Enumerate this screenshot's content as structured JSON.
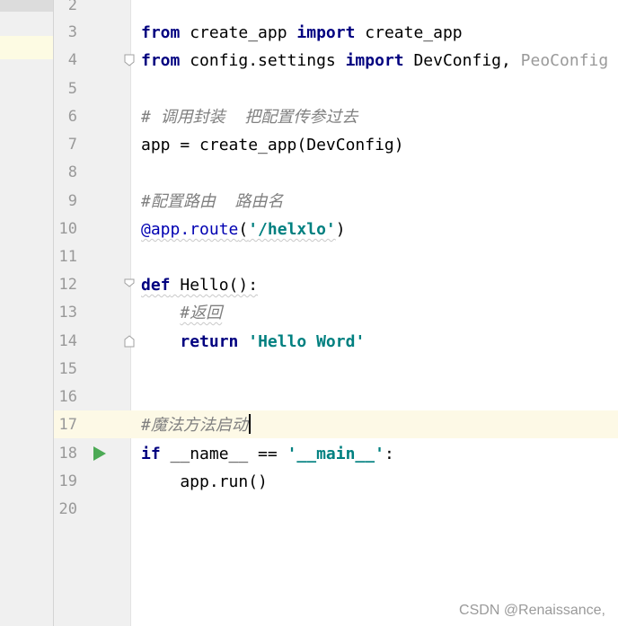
{
  "editor": {
    "line_numbers": [
      "2",
      "3",
      "4",
      "5",
      "6",
      "7",
      "8",
      "9",
      "10",
      "11",
      "12",
      "13",
      "14",
      "15",
      "16",
      "17",
      "18",
      "19",
      "20"
    ],
    "line3": {
      "kw1": "from",
      "mod": " create_app ",
      "kw2": "import",
      "name": " create_app"
    },
    "line4": {
      "kw1": "from",
      "mod": " config.settings ",
      "kw2": "import",
      "name": " DevConfig, ",
      "unused": "PeoConfig"
    },
    "line6": {
      "comment": "# 调用封装  把配置传参过去"
    },
    "line7": {
      "code": "app = create_app(DevConfig)"
    },
    "line9": {
      "comment": "#配置路由  路由名"
    },
    "line10": {
      "decorator": "@app.route",
      "open": "(",
      "string": "'/helxlo'",
      "close": ")"
    },
    "line12": {
      "kw": "def",
      "rest": " Hello():"
    },
    "line13": {
      "indent": "    ",
      "comment": "#返回"
    },
    "line14": {
      "indent": "    ",
      "kw": "return",
      "sp": " ",
      "string": "'Hello Word'"
    },
    "line17": {
      "comment": "#魔法方法启动"
    },
    "line18": {
      "kw": "if",
      "mid": " __name__ == ",
      "string": "'__main__'",
      "colon": ":"
    },
    "line19": {
      "code": "    app.run()"
    }
  },
  "icons": {
    "run": "run-triangle-icon",
    "fold": "fold-marker-icon"
  },
  "colors": {
    "keyword": "#000080",
    "string": "#008080",
    "comment": "#808080",
    "run_icon": "#4caa55",
    "caret_line": "#fdf9e6"
  },
  "watermark": "CSDN @Renaissance,"
}
